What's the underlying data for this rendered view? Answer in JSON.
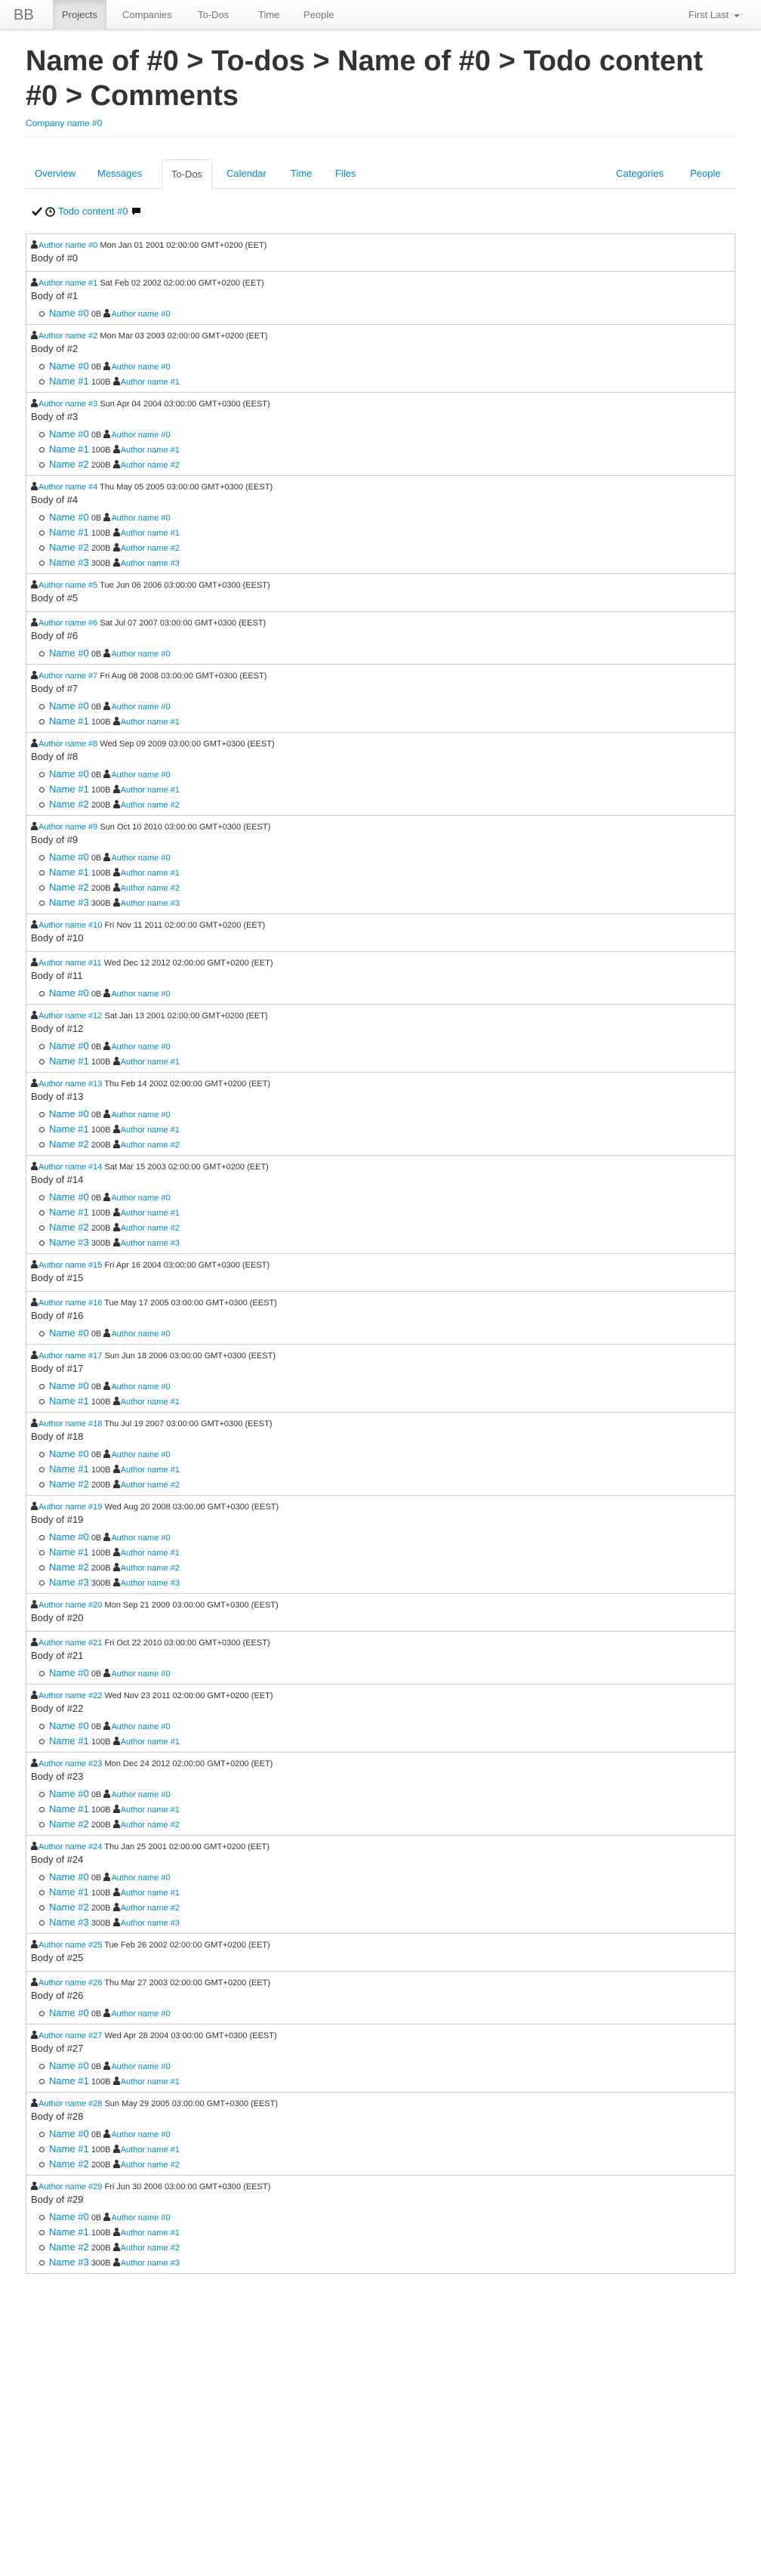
{
  "nav": {
    "brand": "BB",
    "items": [
      {
        "label": "Projects",
        "active": true
      },
      {
        "label": "Companies",
        "active": false
      },
      {
        "label": "To-Dos",
        "active": false
      },
      {
        "label": "Time",
        "active": false
      },
      {
        "label": "People",
        "active": false
      }
    ],
    "user": "First Last"
  },
  "page": {
    "title": "Name of #0 > To-dos > Name of #0 > Todo content #0 > Comments",
    "company": "Company name #0"
  },
  "tabs": {
    "left": [
      "Overview",
      "Messages",
      "To-Dos",
      "Calendar",
      "Time",
      "Files"
    ],
    "active": "To-Dos",
    "right": [
      "Categories",
      "People"
    ]
  },
  "todo": {
    "content": "Todo content #0"
  },
  "comments": [
    {
      "author": "Author name #0",
      "date": "Mon Jan 01 2001 02:00:00 GMT+0200 (EET)",
      "body": "Body of #0",
      "files": []
    },
    {
      "author": "Author name #1",
      "date": "Sat Feb 02 2002 02:00:00 GMT+0200 (EET)",
      "body": "Body of #1",
      "files": [
        {
          "name": "Name #0",
          "size": "0B",
          "author": "Author name #0"
        }
      ]
    },
    {
      "author": "Author name #2",
      "date": "Mon Mar 03 2003 02:00:00 GMT+0200 (EET)",
      "body": "Body of #2",
      "files": [
        {
          "name": "Name #0",
          "size": "0B",
          "author": "Author name #0"
        },
        {
          "name": "Name #1",
          "size": "100B",
          "author": "Author name #1"
        }
      ]
    },
    {
      "author": "Author name #3",
      "date": "Sun Apr 04 2004 03:00:00 GMT+0300 (EEST)",
      "body": "Body of #3",
      "files": [
        {
          "name": "Name #0",
          "size": "0B",
          "author": "Author name #0"
        },
        {
          "name": "Name #1",
          "size": "100B",
          "author": "Author name #1"
        },
        {
          "name": "Name #2",
          "size": "200B",
          "author": "Author name #2"
        }
      ]
    },
    {
      "author": "Author name #4",
      "date": "Thu May 05 2005 03:00:00 GMT+0300 (EEST)",
      "body": "Body of #4",
      "files": [
        {
          "name": "Name #0",
          "size": "0B",
          "author": "Author name #0"
        },
        {
          "name": "Name #1",
          "size": "100B",
          "author": "Author name #1"
        },
        {
          "name": "Name #2",
          "size": "200B",
          "author": "Author name #2"
        },
        {
          "name": "Name #3",
          "size": "300B",
          "author": "Author name #3"
        }
      ]
    },
    {
      "author": "Author name #5",
      "date": "Tue Jun 06 2006 03:00:00 GMT+0300 (EEST)",
      "body": "Body of #5",
      "files": []
    },
    {
      "author": "Author name #6",
      "date": "Sat Jul 07 2007 03:00:00 GMT+0300 (EEST)",
      "body": "Body of #6",
      "files": [
        {
          "name": "Name #0",
          "size": "0B",
          "author": "Author name #0"
        }
      ]
    },
    {
      "author": "Author name #7",
      "date": "Fri Aug 08 2008 03:00:00 GMT+0300 (EEST)",
      "body": "Body of #7",
      "files": [
        {
          "name": "Name #0",
          "size": "0B",
          "author": "Author name #0"
        },
        {
          "name": "Name #1",
          "size": "100B",
          "author": "Author name #1"
        }
      ]
    },
    {
      "author": "Author name #8",
      "date": "Wed Sep 09 2009 03:00:00 GMT+0300 (EEST)",
      "body": "Body of #8",
      "files": [
        {
          "name": "Name #0",
          "size": "0B",
          "author": "Author name #0"
        },
        {
          "name": "Name #1",
          "size": "100B",
          "author": "Author name #1"
        },
        {
          "name": "Name #2",
          "size": "200B",
          "author": "Author name #2"
        }
      ]
    },
    {
      "author": "Author name #9",
      "date": "Sun Oct 10 2010 03:00:00 GMT+0300 (EEST)",
      "body": "Body of #9",
      "files": [
        {
          "name": "Name #0",
          "size": "0B",
          "author": "Author name #0"
        },
        {
          "name": "Name #1",
          "size": "100B",
          "author": "Author name #1"
        },
        {
          "name": "Name #2",
          "size": "200B",
          "author": "Author name #2"
        },
        {
          "name": "Name #3",
          "size": "300B",
          "author": "Author name #3"
        }
      ]
    },
    {
      "author": "Author name #10",
      "date": "Fri Nov 11 2011 02:00:00 GMT+0200 (EET)",
      "body": "Body of #10",
      "files": []
    },
    {
      "author": "Author name #11",
      "date": "Wed Dec 12 2012 02:00:00 GMT+0200 (EET)",
      "body": "Body of #11",
      "files": [
        {
          "name": "Name #0",
          "size": "0B",
          "author": "Author name #0"
        }
      ]
    },
    {
      "author": "Author name #12",
      "date": "Sat Jan 13 2001 02:00:00 GMT+0200 (EET)",
      "body": "Body of #12",
      "files": [
        {
          "name": "Name #0",
          "size": "0B",
          "author": "Author name #0"
        },
        {
          "name": "Name #1",
          "size": "100B",
          "author": "Author name #1"
        }
      ]
    },
    {
      "author": "Author name #13",
      "date": "Thu Feb 14 2002 02:00:00 GMT+0200 (EET)",
      "body": "Body of #13",
      "files": [
        {
          "name": "Name #0",
          "size": "0B",
          "author": "Author name #0"
        },
        {
          "name": "Name #1",
          "size": "100B",
          "author": "Author name #1"
        },
        {
          "name": "Name #2",
          "size": "200B",
          "author": "Author name #2"
        }
      ]
    },
    {
      "author": "Author name #14",
      "date": "Sat Mar 15 2003 02:00:00 GMT+0200 (EET)",
      "body": "Body of #14",
      "files": [
        {
          "name": "Name #0",
          "size": "0B",
          "author": "Author name #0"
        },
        {
          "name": "Name #1",
          "size": "100B",
          "author": "Author name #1"
        },
        {
          "name": "Name #2",
          "size": "200B",
          "author": "Author name #2"
        },
        {
          "name": "Name #3",
          "size": "300B",
          "author": "Author name #3"
        }
      ]
    },
    {
      "author": "Author name #15",
      "date": "Fri Apr 16 2004 03:00:00 GMT+0300 (EEST)",
      "body": "Body of #15",
      "files": []
    },
    {
      "author": "Author name #16",
      "date": "Tue May 17 2005 03:00:00 GMT+0300 (EEST)",
      "body": "Body of #16",
      "files": [
        {
          "name": "Name #0",
          "size": "0B",
          "author": "Author name #0"
        }
      ]
    },
    {
      "author": "Author name #17",
      "date": "Sun Jun 18 2006 03:00:00 GMT+0300 (EEST)",
      "body": "Body of #17",
      "files": [
        {
          "name": "Name #0",
          "size": "0B",
          "author": "Author name #0"
        },
        {
          "name": "Name #1",
          "size": "100B",
          "author": "Author name #1"
        }
      ]
    },
    {
      "author": "Author name #18",
      "date": "Thu Jul 19 2007 03:00:00 GMT+0300 (EEST)",
      "body": "Body of #18",
      "files": [
        {
          "name": "Name #0",
          "size": "0B",
          "author": "Author name #0"
        },
        {
          "name": "Name #1",
          "size": "100B",
          "author": "Author name #1"
        },
        {
          "name": "Name #2",
          "size": "200B",
          "author": "Author name #2"
        }
      ]
    },
    {
      "author": "Author name #19",
      "date": "Wed Aug 20 2008 03:00:00 GMT+0300 (EEST)",
      "body": "Body of #19",
      "files": [
        {
          "name": "Name #0",
          "size": "0B",
          "author": "Author name #0"
        },
        {
          "name": "Name #1",
          "size": "100B",
          "author": "Author name #1"
        },
        {
          "name": "Name #2",
          "size": "200B",
          "author": "Author name #2"
        },
        {
          "name": "Name #3",
          "size": "300B",
          "author": "Author name #3"
        }
      ]
    },
    {
      "author": "Author name #20",
      "date": "Mon Sep 21 2009 03:00:00 GMT+0300 (EEST)",
      "body": "Body of #20",
      "files": []
    },
    {
      "author": "Author name #21",
      "date": "Fri Oct 22 2010 03:00:00 GMT+0300 (EEST)",
      "body": "Body of #21",
      "files": [
        {
          "name": "Name #0",
          "size": "0B",
          "author": "Author name #0"
        }
      ]
    },
    {
      "author": "Author name #22",
      "date": "Wed Nov 23 2011 02:00:00 GMT+0200 (EET)",
      "body": "Body of #22",
      "files": [
        {
          "name": "Name #0",
          "size": "0B",
          "author": "Author name #0"
        },
        {
          "name": "Name #1",
          "size": "100B",
          "author": "Author name #1"
        }
      ]
    },
    {
      "author": "Author name #23",
      "date": "Mon Dec 24 2012 02:00:00 GMT+0200 (EET)",
      "body": "Body of #23",
      "files": [
        {
          "name": "Name #0",
          "size": "0B",
          "author": "Author name #0"
        },
        {
          "name": "Name #1",
          "size": "100B",
          "author": "Author name #1"
        },
        {
          "name": "Name #2",
          "size": "200B",
          "author": "Author name #2"
        }
      ]
    },
    {
      "author": "Author name #24",
      "date": "Thu Jan 25 2001 02:00:00 GMT+0200 (EET)",
      "body": "Body of #24",
      "files": [
        {
          "name": "Name #0",
          "size": "0B",
          "author": "Author name #0"
        },
        {
          "name": "Name #1",
          "size": "100B",
          "author": "Author name #1"
        },
        {
          "name": "Name #2",
          "size": "200B",
          "author": "Author name #2"
        },
        {
          "name": "Name #3",
          "size": "300B",
          "author": "Author name #3"
        }
      ]
    },
    {
      "author": "Author name #25",
      "date": "Tue Feb 26 2002 02:00:00 GMT+0200 (EET)",
      "body": "Body of #25",
      "files": []
    },
    {
      "author": "Author name #26",
      "date": "Thu Mar 27 2003 02:00:00 GMT+0200 (EET)",
      "body": "Body of #26",
      "files": [
        {
          "name": "Name #0",
          "size": "0B",
          "author": "Author name #0"
        }
      ]
    },
    {
      "author": "Author name #27",
      "date": "Wed Apr 28 2004 03:00:00 GMT+0300 (EEST)",
      "body": "Body of #27",
      "files": [
        {
          "name": "Name #0",
          "size": "0B",
          "author": "Author name #0"
        },
        {
          "name": "Name #1",
          "size": "100B",
          "author": "Author name #1"
        }
      ]
    },
    {
      "author": "Author name #28",
      "date": "Sun May 29 2005 03:00:00 GMT+0300 (EEST)",
      "body": "Body of #28",
      "files": [
        {
          "name": "Name #0",
          "size": "0B",
          "author": "Author name #0"
        },
        {
          "name": "Name #1",
          "size": "100B",
          "author": "Author name #1"
        },
        {
          "name": "Name #2",
          "size": "200B",
          "author": "Author name #2"
        }
      ]
    },
    {
      "author": "Author name #29",
      "date": "Fri Jun 30 2006 03:00:00 GMT+0300 (EEST)",
      "body": "Body of #29",
      "files": [
        {
          "name": "Name #0",
          "size": "0B",
          "author": "Author name #0"
        },
        {
          "name": "Name #1",
          "size": "100B",
          "author": "Author name #1"
        },
        {
          "name": "Name #2",
          "size": "200B",
          "author": "Author name #2"
        },
        {
          "name": "Name #3",
          "size": "300B",
          "author": "Author name #3"
        }
      ]
    }
  ]
}
